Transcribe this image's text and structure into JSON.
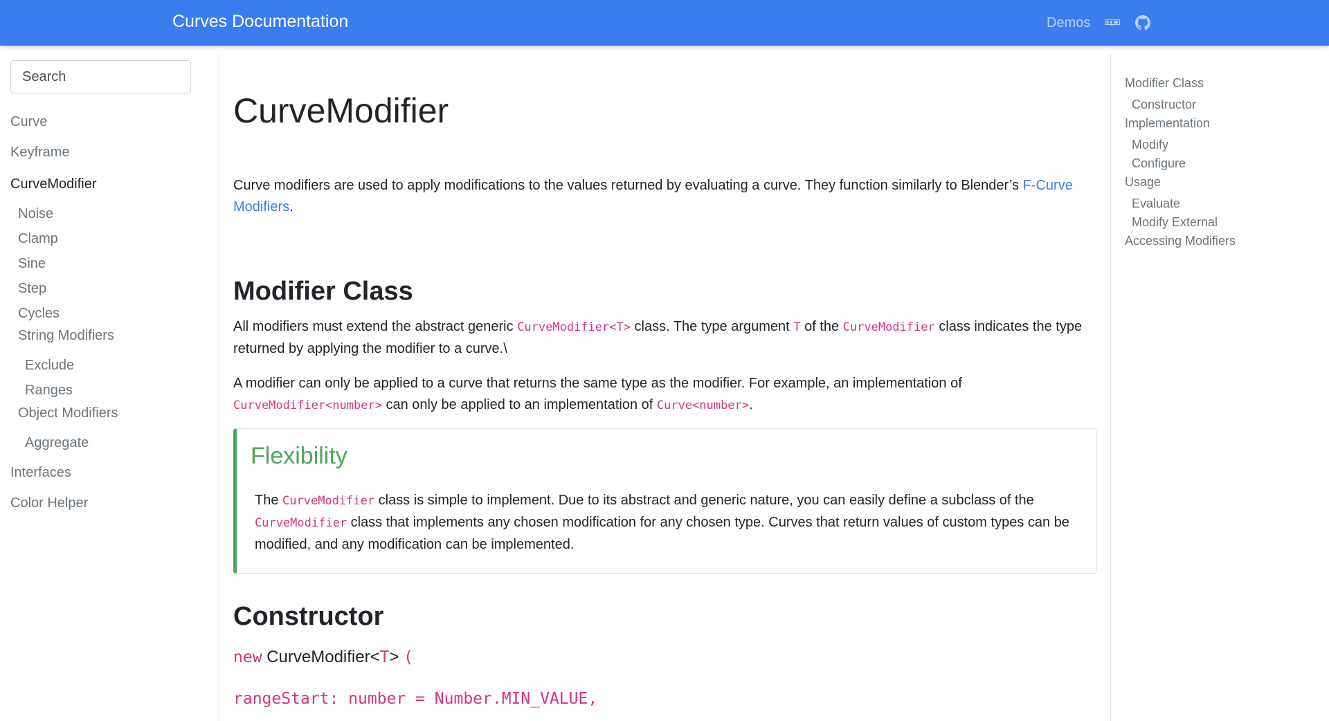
{
  "navbar": {
    "brand": "Curves Documentation",
    "demos": "Demos",
    "icons": [
      "npm-icon",
      "github-icon"
    ]
  },
  "sidebar": {
    "search_placeholder": "Search",
    "items": [
      {
        "label": "Curve",
        "level": 0,
        "active": false
      },
      {
        "label": "Keyframe",
        "level": 0,
        "active": false
      },
      {
        "label": "CurveModifier",
        "level": 0,
        "active": true
      },
      {
        "label": "Noise",
        "level": 1,
        "active": false
      },
      {
        "label": "Clamp",
        "level": 1,
        "active": false
      },
      {
        "label": "Sine",
        "level": 1,
        "active": false
      },
      {
        "label": "Step",
        "level": 1,
        "active": false
      },
      {
        "label": "Cycles",
        "level": 1,
        "active": false
      },
      {
        "label": "String Modifiers",
        "level": 1,
        "active": false
      },
      {
        "label": "Exclude",
        "level": 2,
        "active": false
      },
      {
        "label": "Ranges",
        "level": 2,
        "active": false
      },
      {
        "label": "Object Modifiers",
        "level": 1,
        "active": false
      },
      {
        "label": "Aggregate",
        "level": 2,
        "active": false
      },
      {
        "label": "Interfaces",
        "level": 0,
        "active": false
      },
      {
        "label": "Color Helper",
        "level": 0,
        "active": false
      }
    ]
  },
  "main": {
    "title": "CurveModifier",
    "intro": {
      "text": "Curve modifiers are used to apply modifications to the values returned by evaluating a curve. They function similarly to Blender’s ",
      "link": "F-Curve Modifiers",
      "end": "."
    },
    "modifier_class": {
      "heading": "Modifier Class",
      "p1": {
        "a": "All modifiers must extend the abstract generic ",
        "code1": "CurveModifier<T>",
        "b": " class. The type argument ",
        "code2": "T",
        "c": " of the ",
        "code3": "CurveModifier",
        "d": " class indicates the type returned by applying the modifier to a curve.\\"
      },
      "p2": {
        "a": "A modifier can only be applied to a curve that returns the same type as the modifier. For example, an implementation of ",
        "code1": "CurveModifier<number>",
        "b": " can only be applied to an implementation of ",
        "code2": "Curve<number>",
        "c": "."
      }
    },
    "callout": {
      "title": "Flexibility",
      "a": "The ",
      "code1": "CurveModifier",
      "b": " class is simple to implement. Due to its abstract and generic nature, you can easily define a subclass of the ",
      "code2": "CurveModifier",
      "c": " class that implements any chosen modification for any chosen type. Curves that return values of custom types can be modified, and any modification can be implemented."
    },
    "constructor": {
      "heading": "Constructor",
      "kw": "new",
      "name": " CurveModifier<",
      "generic": "T",
      "close": "> ",
      "paren": "(",
      "param": "rangeStart: number = Number.MIN_VALUE,"
    }
  },
  "toc": {
    "items": [
      {
        "label": "Modifier Class",
        "level": 0
      },
      {
        "label": "Constructor",
        "level": 1
      },
      {
        "label": "Implementation",
        "level": 0
      },
      {
        "label": "Modify",
        "level": 1
      },
      {
        "label": "Configure",
        "level": 1
      },
      {
        "label": "Usage",
        "level": 0
      },
      {
        "label": "Evaluate",
        "level": 1
      },
      {
        "label": "Modify External",
        "level": 1
      },
      {
        "label": "Accessing Modifiers",
        "level": 0
      }
    ]
  }
}
